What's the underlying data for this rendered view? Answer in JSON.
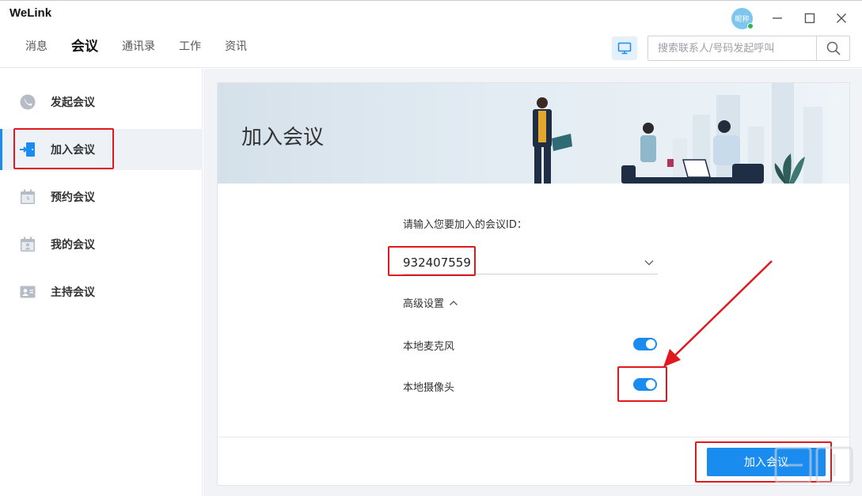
{
  "app": {
    "title": "WeLink"
  },
  "nav": {
    "tabs": [
      {
        "label": "消息"
      },
      {
        "label": "会议",
        "active": true
      },
      {
        "label": "通讯录"
      },
      {
        "label": "工作"
      },
      {
        "label": "资讯"
      }
    ]
  },
  "user": {
    "avatar_text": "昵称"
  },
  "search": {
    "placeholder": "搜索联系人/号码发起呼叫"
  },
  "sidebar": {
    "items": [
      {
        "label": "发起会议",
        "icon": "call-bubble-icon"
      },
      {
        "label": "加入会议",
        "icon": "join-door-icon",
        "active": true
      },
      {
        "label": "预约会议",
        "icon": "calendar-clock-icon"
      },
      {
        "label": "我的会议",
        "icon": "calendar-person-icon"
      },
      {
        "label": "主持会议",
        "icon": "host-card-icon"
      }
    ]
  },
  "main": {
    "banner_title": "加入会议",
    "id_label": "请输入您要加入的会议ID：",
    "meeting_id": "932407559",
    "advanced_label": "高级设置",
    "options": [
      {
        "label": "本地麦克风",
        "on": true
      },
      {
        "label": "本地摄像头",
        "on": true
      }
    ],
    "join_button": "加入会议"
  },
  "colors": {
    "accent": "#1a8cf0",
    "highlight": "#e0191e"
  }
}
